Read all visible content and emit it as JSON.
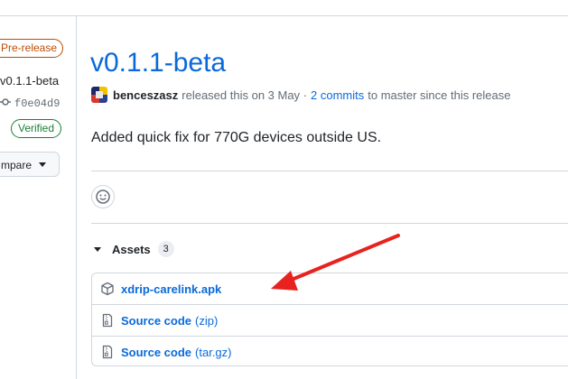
{
  "sidebar": {
    "prerelease_badge": "Pre-release",
    "tag_name": "v0.1.1-beta",
    "commit_sha": "f0e04d9",
    "verified_badge": "Verified",
    "compare_label": "mpare"
  },
  "release": {
    "title": "v0.1.1-beta",
    "author": "benceszasz",
    "released_text": "released this on 3 May ·",
    "commits_link": "2 commits",
    "commits_suffix": "to master since this release",
    "body": "Added quick fix for 770G devices outside US."
  },
  "assets": {
    "heading": "Assets",
    "count": "3",
    "items": [
      {
        "name": "xdrip-carelink.apk",
        "suffix": "",
        "icon": "package-icon"
      },
      {
        "name": "Source code",
        "suffix": "(zip)",
        "icon": "file-zip-icon"
      },
      {
        "name": "Source code",
        "suffix": "(tar.gz)",
        "icon": "file-zip-icon"
      }
    ]
  },
  "annotation": {
    "color": "#e8221e"
  }
}
